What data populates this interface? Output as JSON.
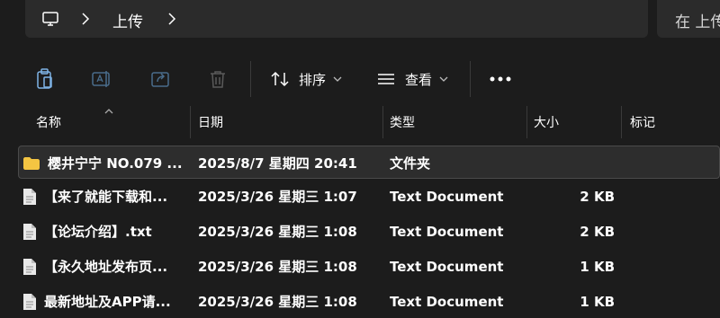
{
  "address": {
    "crumbs": [
      "上传"
    ]
  },
  "search": {
    "placeholder": "在 上传"
  },
  "toolbar": {
    "sort_label": "排序",
    "view_label": "查看"
  },
  "columns": {
    "name": "名称",
    "date": "日期",
    "type": "类型",
    "size": "大小",
    "tags": "标记"
  },
  "files": [
    {
      "name": "樱井宁宁 NO.079 ...",
      "date": "2025/8/7 星期四 20:41",
      "type": "文件夹",
      "size": "",
      "kind": "folder",
      "selected": true
    },
    {
      "name": "【来了就能下载和...",
      "date": "2025/3/26 星期三 1:07",
      "type": "Text Document",
      "size": "2 KB",
      "kind": "text"
    },
    {
      "name": "【论坛介绍】.txt",
      "date": "2025/3/26 星期三 1:08",
      "type": "Text Document",
      "size": "2 KB",
      "kind": "text"
    },
    {
      "name": "【永久地址发布页...",
      "date": "2025/3/26 星期三 1:08",
      "type": "Text Document",
      "size": "1 KB",
      "kind": "text"
    },
    {
      "name": "最新地址及APP请...",
      "date": "2025/3/26 星期三 1:08",
      "type": "Text Document",
      "size": "1 KB",
      "kind": "text"
    }
  ],
  "colors": {
    "background": "#1c1c1c",
    "folder": "#f4c542",
    "selected_row": "#2d2d2d"
  }
}
